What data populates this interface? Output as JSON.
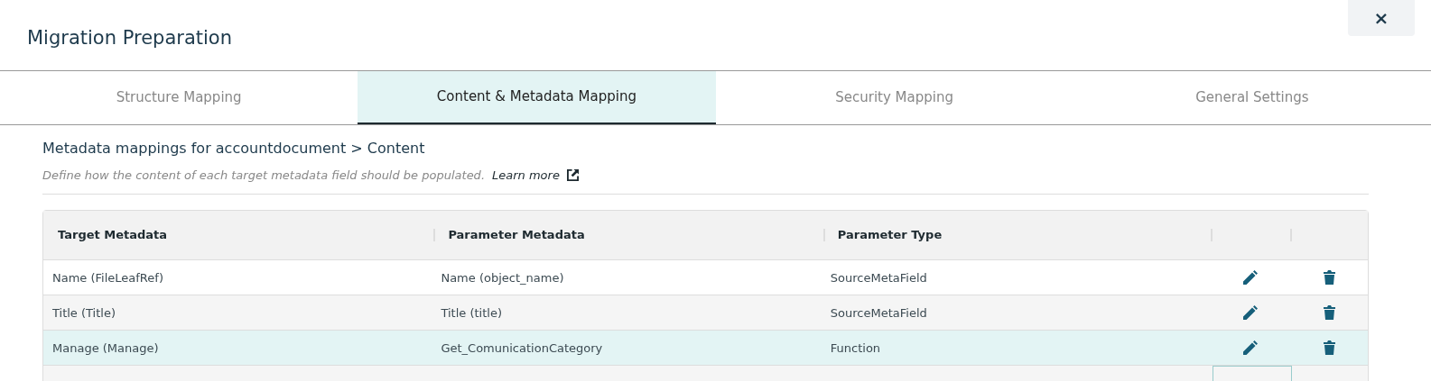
{
  "dialog": {
    "title": "Migration Preparation",
    "close": "×"
  },
  "tabs": [
    {
      "label": "Structure Mapping",
      "selected": false
    },
    {
      "label": "Content & Metadata Mapping",
      "selected": true
    },
    {
      "label": "Security Mapping",
      "selected": false
    },
    {
      "label": "General Settings",
      "selected": false
    }
  ],
  "section": {
    "heading": "Metadata mappings for accountdocument > Content",
    "description": "Define how the content of each target metadata field should be populated.",
    "link": "Learn more"
  },
  "table": {
    "columns": [
      "Target Metadata",
      "Parameter Metadata",
      "Parameter Type"
    ],
    "rows": [
      {
        "cells": [
          "Name (FileLeafRef)",
          "Name (object_name)",
          "SourceMetaField"
        ],
        "selected": false
      },
      {
        "cells": [
          "Title (Title)",
          "Title (title)",
          "SourceMetaField"
        ],
        "selected": false
      },
      {
        "cells": [
          "Manage (Manage)",
          "Get_ComunicationCategory",
          "Function"
        ],
        "selected": true
      }
    ]
  }
}
